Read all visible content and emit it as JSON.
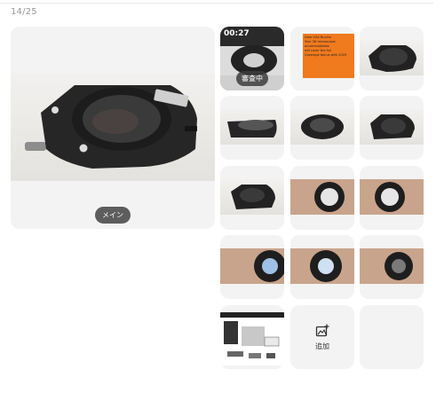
{
  "header": {
    "counter": "14/25"
  },
  "main": {
    "badge": "メイン"
  },
  "video_tile": {
    "duration": "00:27",
    "status": "審査中"
  },
  "ad_tile": {
    "lines": [
      "Dear USA Buyers",
      "Your 3D microscope accommodation",
      "will cover the full",
      "Coverage bonus with 2020"
    ]
  },
  "add_tile": {
    "label": "追加",
    "icon": "add-image-icon"
  },
  "colors": {
    "ad_orange": "#f07a1e",
    "badge_bg": "#5d5d5d",
    "tile_bg": "#f3f3f3"
  }
}
